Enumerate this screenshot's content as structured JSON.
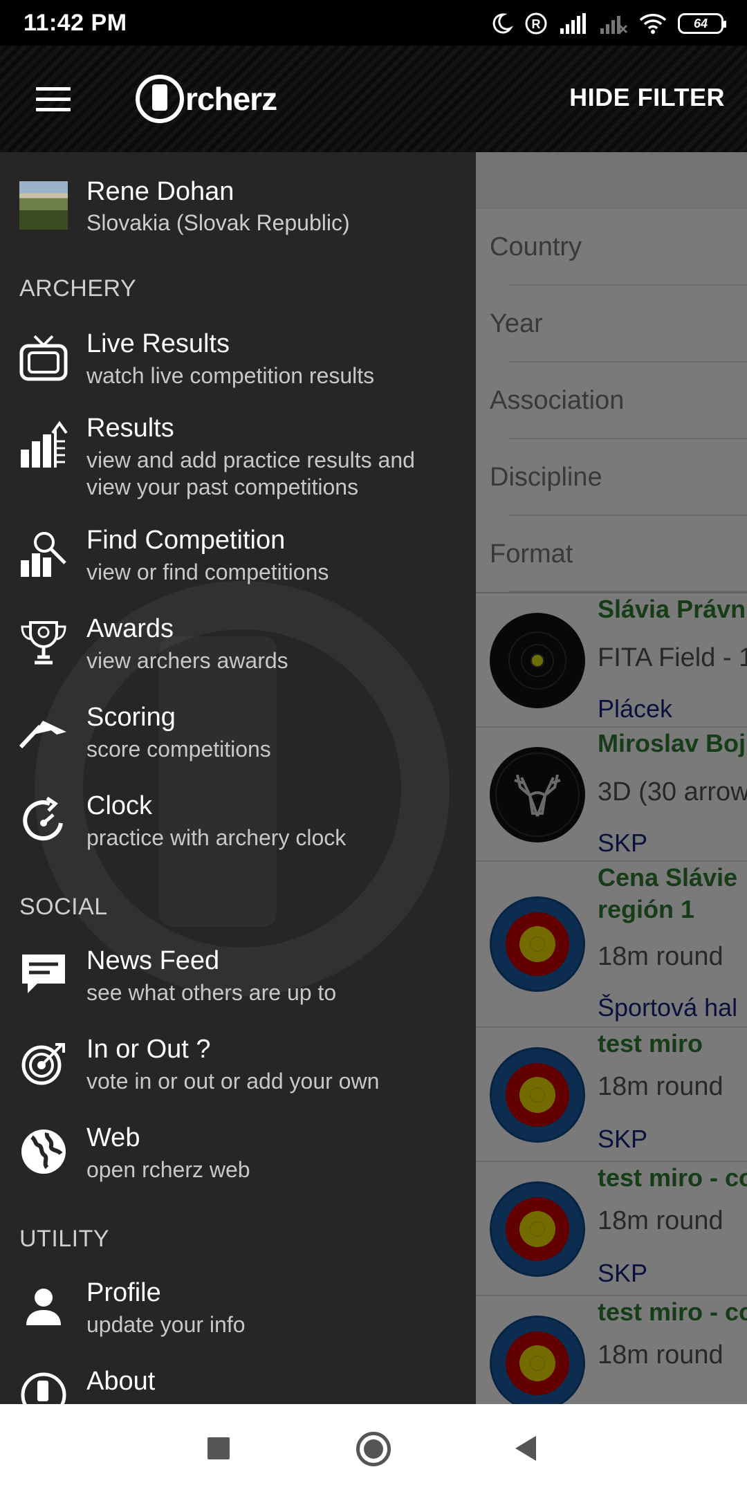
{
  "status_bar": {
    "time": "11:42 PM",
    "battery": "64"
  },
  "app_bar": {
    "brand": "rcherz",
    "action": "HIDE FILTER"
  },
  "filter": {
    "fields": [
      "Country",
      "Year",
      "Association",
      "Discipline",
      "Format"
    ]
  },
  "competitions": [
    {
      "title": "Slávia Právn",
      "subtitle": "FITA Field - 1",
      "location": "Plácek",
      "target": "black"
    },
    {
      "title": "Miroslav Boj",
      "subtitle": "3D (30 arrow",
      "location": "SKP",
      "target": "deer"
    },
    {
      "title": "Cena Slávie",
      "title2": "región 1",
      "subtitle": "18m round",
      "location": "Športová hal",
      "target": "fita"
    },
    {
      "title": "test miro",
      "subtitle": "18m round",
      "location": "SKP",
      "target": "fita"
    },
    {
      "title": "test miro - co",
      "subtitle": "18m round",
      "location": "SKP",
      "target": "fita"
    },
    {
      "title": "test miro - co",
      "subtitle": "18m round",
      "location": "",
      "target": "fita"
    }
  ],
  "drawer": {
    "user": {
      "name": "Rene Dohan",
      "country": "Slovakia (Slovak Republic)"
    },
    "sections": {
      "archery": "ARCHERY",
      "social": "SOCIAL",
      "utility": "UTILITY"
    },
    "items": {
      "live_results": {
        "label": "Live Results",
        "desc": "watch live competition results",
        "icon": "tv-icon"
      },
      "results": {
        "label": "Results",
        "desc": "view and add practice results and view your past competitions",
        "icon": "bar-chart-icon"
      },
      "find_competition": {
        "label": "Find Competition",
        "desc": "view or find competitions",
        "icon": "search-chart-icon"
      },
      "awards": {
        "label": "Awards",
        "desc": "view archers awards",
        "icon": "trophy-icon"
      },
      "scoring": {
        "label": "Scoring",
        "desc": "score competitions",
        "icon": "arrow-up-icon"
      },
      "clock": {
        "label": "Clock",
        "desc": "practice with archery clock",
        "icon": "clock-icon"
      },
      "news_feed": {
        "label": "News Feed",
        "desc": "see what others are up to",
        "icon": "chat-icon"
      },
      "in_or_out": {
        "label": "In or Out ?",
        "desc": "vote in or out or add your own",
        "icon": "target-icon"
      },
      "web": {
        "label": "Web",
        "desc": "open rcherz web",
        "icon": "globe-icon"
      },
      "profile": {
        "label": "Profile",
        "desc": "update your info",
        "icon": "person-icon"
      },
      "about": {
        "label": "About",
        "desc": "",
        "icon": "logo-icon"
      }
    }
  }
}
